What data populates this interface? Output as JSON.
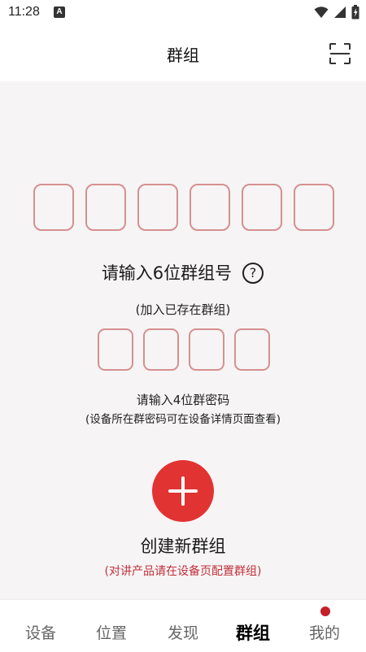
{
  "status": {
    "time": "11:28",
    "notification_icon": "A"
  },
  "header": {
    "title": "群组"
  },
  "group_code": {
    "digits": [
      "",
      "",
      "",
      "",
      "",
      ""
    ],
    "prompt": "请输入6位群组号",
    "help": "?",
    "subtitle": "(加入已存在群组)"
  },
  "group_password": {
    "digits": [
      "",
      "",
      "",
      ""
    ],
    "prompt": "请输入4位群密码",
    "hint": "(设备所在群密码可在设备详情页面查看)"
  },
  "create": {
    "label": "创建新群组",
    "note": "(对讲产品请在设备页配置群组)"
  },
  "tabs": [
    {
      "label": "设备",
      "active": false
    },
    {
      "label": "位置",
      "active": false
    },
    {
      "label": "发现",
      "active": false
    },
    {
      "label": "群组",
      "active": true
    },
    {
      "label": "我的",
      "active": false,
      "badge": true
    }
  ],
  "colors": {
    "accent": "#e23333",
    "box_border": "#d5908f",
    "note": "#c0303a",
    "background": "#f6f4f5"
  }
}
